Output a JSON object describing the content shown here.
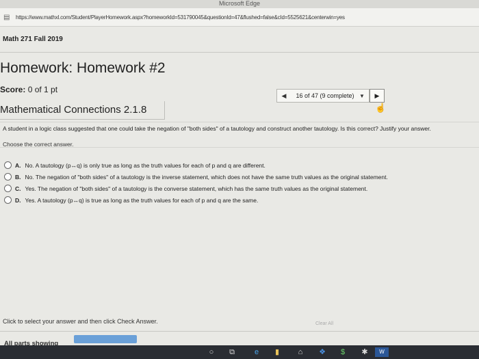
{
  "browser": {
    "title": "Microsoft Edge",
    "url": "https://www.mathxl.com/Student/PlayerHomework.aspx?homeworkId=531790045&questionId=47&flushed=false&cId=5525621&centerwin=yes"
  },
  "course": "Math 271 Fall 2019",
  "homework": {
    "title": "Homework: Homework #2",
    "score_label": "Score:",
    "score_value": "0 of 1 pt"
  },
  "nav": {
    "prev": "◀",
    "position": "16 of 47 (9 complete)",
    "dropdown": "▼",
    "next": "▶"
  },
  "section": "Mathematical Connections 2.1.8",
  "question": {
    "text": "A student in a logic class suggested that one could take the negation of \"both sides\" of a tautology and construct another tautology. Is this correct? Justify your answer.",
    "prompt": "Choose the correct answer."
  },
  "options": [
    {
      "letter": "A.",
      "text": "No. A tautology (p↔q) is only true as long as the truth values for each of p and q are different."
    },
    {
      "letter": "B.",
      "text": "No. The negation of \"both sides\" of a tautology is the inverse statement, which does not have the same truth values as the original statement."
    },
    {
      "letter": "C.",
      "text": "Yes. The negation of \"both sides\" of a tautology is the converse statement, which has the same truth values as the original statement."
    },
    {
      "letter": "D.",
      "text": "Yes. A tautology (p↔q) is true as long as the truth values for each of p and q are the same."
    }
  ],
  "footer": {
    "instruction": "Click to select your answer and then click Check Answer.",
    "clear_all": "Clear All",
    "all_parts": "All parts showing",
    "progress": 1.0
  },
  "colors": {
    "progress_fill": "#6aa0d8",
    "taskbar": "#2a2d33"
  },
  "taskbar": {
    "icons": [
      "cortana-icon",
      "task-view-icon",
      "edge-icon",
      "explorer-icon",
      "store-icon",
      "dropbox-icon",
      "money-icon",
      "word-icon"
    ]
  }
}
